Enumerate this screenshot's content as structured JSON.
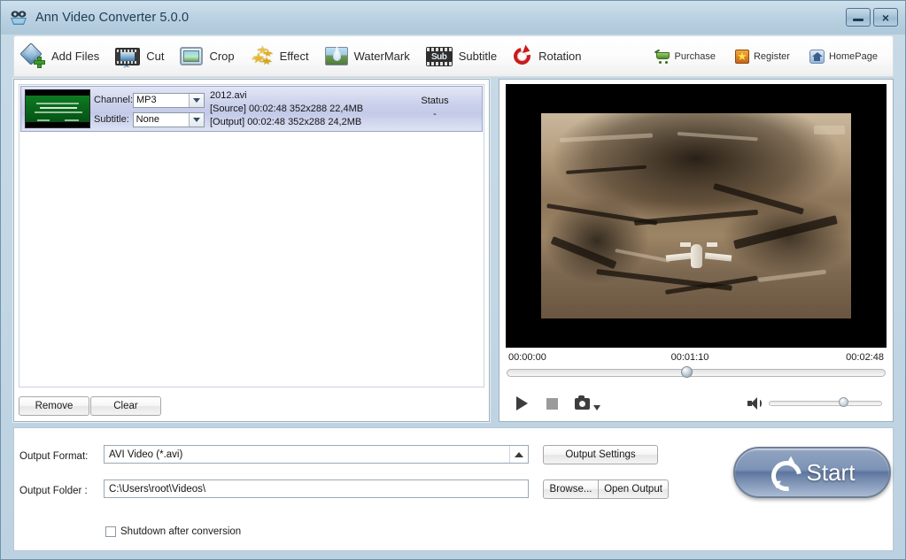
{
  "window": {
    "title": "Ann Video Converter 5.0.0",
    "app_icon": "video-camera-icon",
    "minimize_label": "",
    "close_label": "×"
  },
  "toolbar": {
    "items": [
      {
        "label": "Add Files",
        "icon": "add-files-icon"
      },
      {
        "label": "Cut",
        "icon": "cut-icon"
      },
      {
        "label": "Crop",
        "icon": "crop-icon"
      },
      {
        "label": "Effect",
        "icon": "effect-icon"
      },
      {
        "label": "WaterMark",
        "icon": "watermark-icon"
      },
      {
        "label": "Subtitle",
        "icon": "subtitle-icon"
      },
      {
        "label": "Rotation",
        "icon": "rotation-icon"
      }
    ],
    "right_items": [
      {
        "label": "Purchase",
        "icon": "shopping-cart-icon"
      },
      {
        "label": "Register",
        "icon": "star-badge-icon"
      },
      {
        "label": "HomePage",
        "icon": "home-icon"
      }
    ],
    "subtitle_icon_text": "Sub"
  },
  "file_list": {
    "rows": [
      {
        "channel_label": "Channel:",
        "channel_value": "MP3",
        "subtitle_label": "Subtitle:",
        "subtitle_value": "None",
        "file_name": "2012.avi",
        "source_line": "[Source] 00:02:48  352x288  22,4MB",
        "output_line": "[Output] 00:02:48  352x288  24,2MB",
        "status_header": "Status",
        "status_value": "-"
      }
    ],
    "remove_label": "Remove",
    "clear_label": "Clear"
  },
  "preview": {
    "time_start": "00:00:00",
    "time_current": "00:01:10",
    "time_total": "00:02:48",
    "seek_percent": 46,
    "volume_percent": 62,
    "play_label": "play-button",
    "stop_label": "stop-button",
    "snapshot_label": "snapshot-button"
  },
  "output": {
    "format_label": "Output Format:",
    "format_value": "AVI Video (*.avi)",
    "folder_label": "Output Folder :",
    "folder_value": "C:\\Users\\root\\Videos\\",
    "settings_button": "Output Settings",
    "browse_button": "Browse...",
    "open_output_button": "Open Output",
    "shutdown_label": "Shutdown after conversion",
    "shutdown_checked": false,
    "start_button": "Start"
  },
  "colors": {
    "title_bar": "#bcd2e2",
    "accent_blue": "#5d769e",
    "selected_row": "#ccd2ec",
    "window_border": "#6f93ab"
  }
}
